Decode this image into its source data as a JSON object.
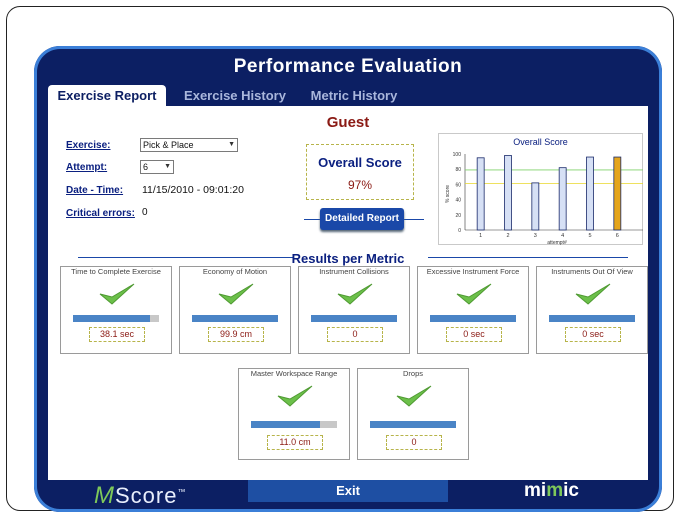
{
  "header": {
    "title": "Performance  Evaluation"
  },
  "tabs": [
    {
      "label": "Exercise Report",
      "active": true
    },
    {
      "label": "Exercise History",
      "active": false
    },
    {
      "label": "Metric History",
      "active": false
    }
  ],
  "user": {
    "name": "Guest"
  },
  "fields": {
    "exercise_label": "Exercise:",
    "exercise_value": "Pick & Place",
    "attempt_label": "Attempt:",
    "attempt_value": "6",
    "datetime_label": "Date - Time:",
    "datetime_value": "11/15/2010  -  09:01:20",
    "errors_label": "Critical errors:",
    "errors_value": "0"
  },
  "score": {
    "title": "Overall Score",
    "value": "97%",
    "detail_button": "Detailed Report"
  },
  "chart_data": {
    "type": "bar",
    "title": "Overall Score",
    "xlabel": "attempt#",
    "ylabel": "% score",
    "categories": [
      "1",
      "2",
      "3",
      "4",
      "5",
      "6"
    ],
    "values": [
      95,
      98,
      62,
      82,
      96,
      96
    ],
    "highlight_index": 5,
    "ylim": [
      0,
      100
    ],
    "yticks": [
      0,
      20,
      40,
      60,
      80,
      100
    ],
    "reference_lines": [
      {
        "value": 79,
        "color": "#7fd06a"
      },
      {
        "value": 61,
        "color": "#e8d72a"
      }
    ],
    "colors": {
      "bar": "#d6e0f5",
      "highlight": "#e4a51c"
    }
  },
  "results": {
    "title": "Results per Metric",
    "metrics": [
      {
        "label": "Time to Complete Exercise",
        "value": "38.1 sec",
        "fill": 0.9
      },
      {
        "label": "Economy of Motion",
        "value": "99.9 cm",
        "fill": 1.0
      },
      {
        "label": "Instrument Collisions",
        "value": "0",
        "fill": 1.0
      },
      {
        "label": "Excessive Instrument Force",
        "value": "0 sec",
        "fill": 1.0
      },
      {
        "label": "Instruments Out Of View",
        "value": "0 sec",
        "fill": 1.0
      },
      {
        "label": "Master Workspace Range",
        "value": "11.0 cm",
        "fill": 0.8
      },
      {
        "label": "Drops",
        "value": "0",
        "fill": 1.0
      }
    ]
  },
  "footer": {
    "brand_m": "M",
    "brand_rest": "Score",
    "brand_tm": "™",
    "exit_label": "Exit",
    "logo_left": "mi",
    "logo_dot": "m",
    "logo_right": "ic"
  }
}
